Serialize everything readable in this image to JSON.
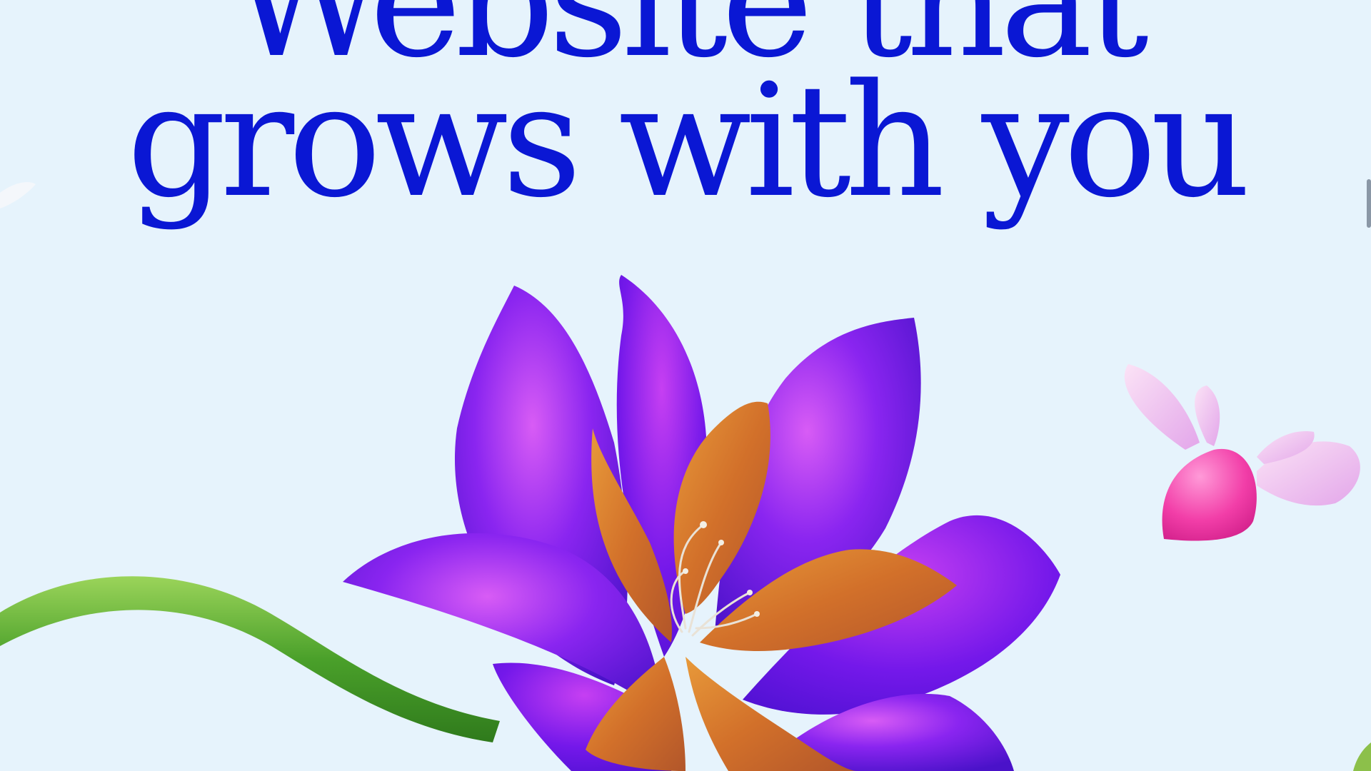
{
  "hero": {
    "line1": "Website that",
    "line2": "grows with you"
  },
  "colors": {
    "background": "#e6f3fc",
    "headline": "#0a17d4",
    "petal_purple": "#7a1cf0",
    "petal_orange": "#d9792e",
    "stem_green": "#4aa02a",
    "bird_pink": "#f23ea8"
  },
  "icons": {
    "scroll": "scrollbar-thumb"
  }
}
